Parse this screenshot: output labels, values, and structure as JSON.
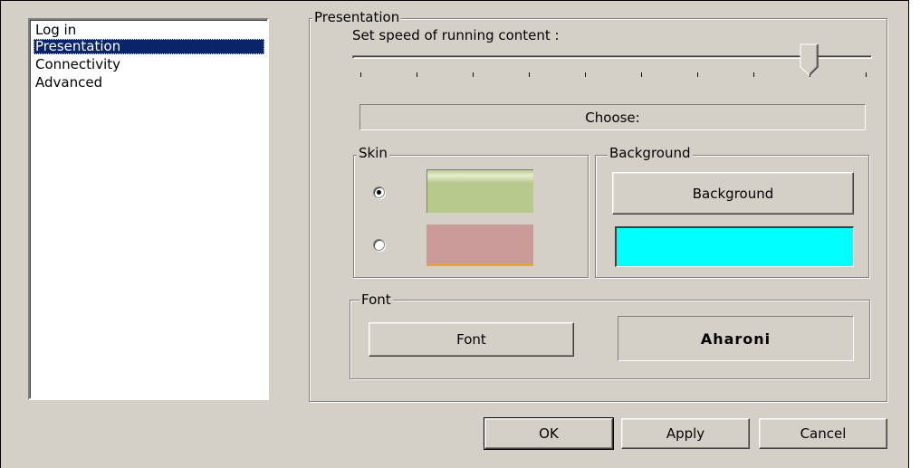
{
  "sidebar": {
    "items": [
      {
        "label": "Log in",
        "selected": false
      },
      {
        "label": "Presentation",
        "selected": true
      },
      {
        "label": "Connectivity",
        "selected": false
      },
      {
        "label": "Advanced",
        "selected": false
      }
    ]
  },
  "presentation": {
    "group_title": "Presentation",
    "speed_label": "Set speed of running content :",
    "speed_slider": {
      "ticks": 10,
      "value_index": 8
    },
    "choose_label": "Choose:",
    "skin": {
      "title": "Skin",
      "options": [
        {
          "checked": true,
          "swatch": "#b8c98e",
          "swatch_light": "#e6efcf"
        },
        {
          "checked": false,
          "swatch": "#c99a98",
          "swatch_accent": "#e8a23c"
        }
      ]
    },
    "background": {
      "title": "Background",
      "button_label": "Background",
      "color": "#00ffff"
    },
    "font": {
      "title": "Font",
      "button_label": "Font",
      "preview": "Aharoni"
    }
  },
  "footer": {
    "ok_label": "OK",
    "apply_label": "Apply",
    "cancel_label": "Cancel"
  }
}
